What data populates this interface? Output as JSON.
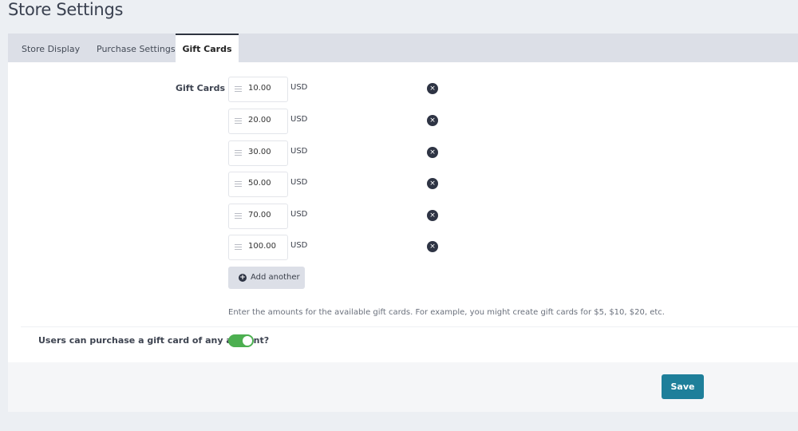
{
  "page": {
    "title": "Store Settings"
  },
  "tabs": [
    {
      "label": "Store Display",
      "active": false
    },
    {
      "label": "Purchase Settings",
      "active": false
    },
    {
      "label": "Gift Cards",
      "active": true
    }
  ],
  "gift_cards": {
    "label": "Gift Cards",
    "currency": "USD",
    "amounts": [
      "10.00",
      "20.00",
      "30.00",
      "50.00",
      "70.00",
      "100.00"
    ],
    "add_label": "Add another",
    "help_text": "Enter the amounts for the available gift cards. For example, you might create gift cards for $5, $10, $20, etc.",
    "remove_icon": "close-icon",
    "drag_icon": "drag-handle-icon"
  },
  "any_amount": {
    "label": "Users can purchase a gift card of any amount?",
    "enabled": true
  },
  "footer": {
    "save_label": "Save"
  },
  "colors": {
    "accent": "#1e7f9a",
    "toggle_on": "#4caf50",
    "dark_icon": "#2e3444"
  }
}
